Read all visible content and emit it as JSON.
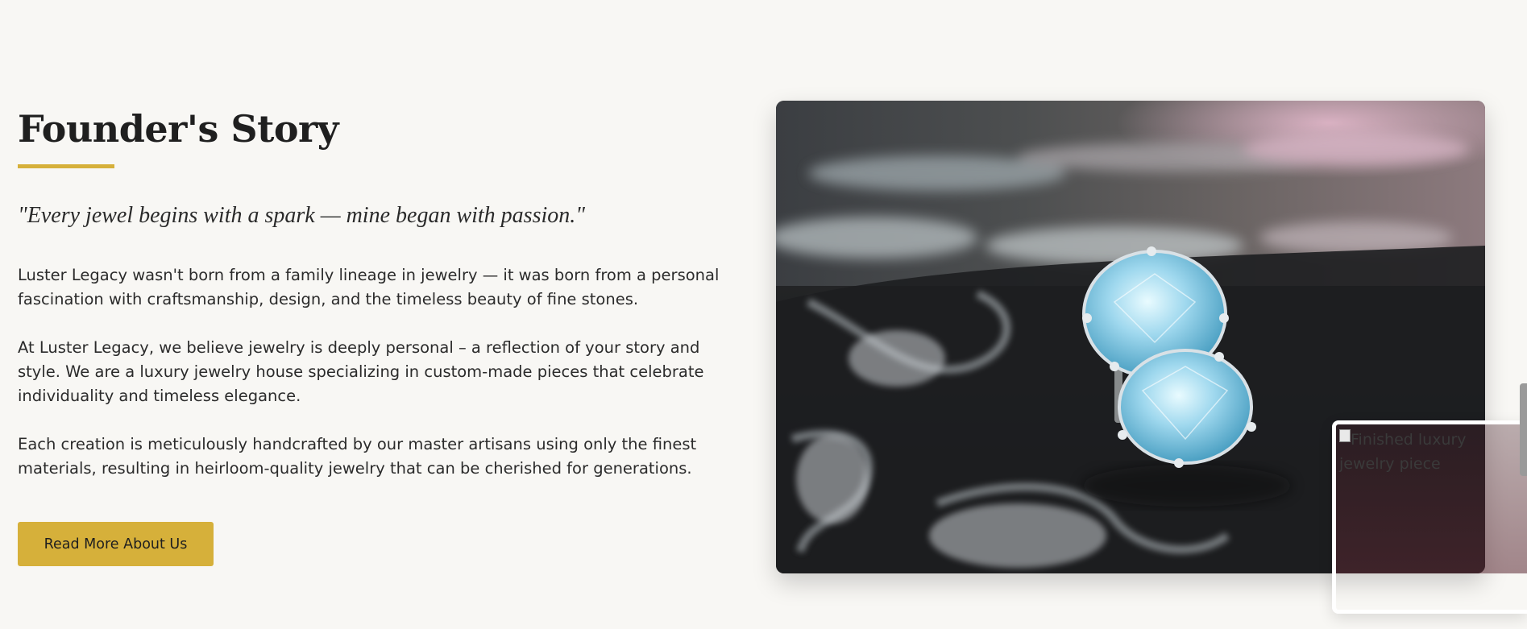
{
  "section": {
    "title": "Founder's Story",
    "quote": "\"Every jewel begins with a spark — mine began with passion.\"",
    "paragraphs": [
      "Luster Legacy wasn't born from a family lineage in jewelry — it was born from a personal fascination with craftsmanship, design, and the timeless beauty of fine stones.",
      "At Luster Legacy, we believe jewelry is deeply personal – a reflection of your story and style. We are a luxury jewelry house specializing in custom-made pieces that celebrate individuality and timeless elegance.",
      "Each creation is meticulously handcrafted by our master artisans using only the finest materials, resulting in heirloom-quality jewelry that can be cherished for generations."
    ],
    "cta_label": "Read More About Us"
  },
  "images": {
    "secondary_alt": "Finished luxury jewelry piece"
  },
  "colors": {
    "accent": "#d6b03a",
    "background": "#f8f7f4",
    "text": "#2b2b2b"
  }
}
